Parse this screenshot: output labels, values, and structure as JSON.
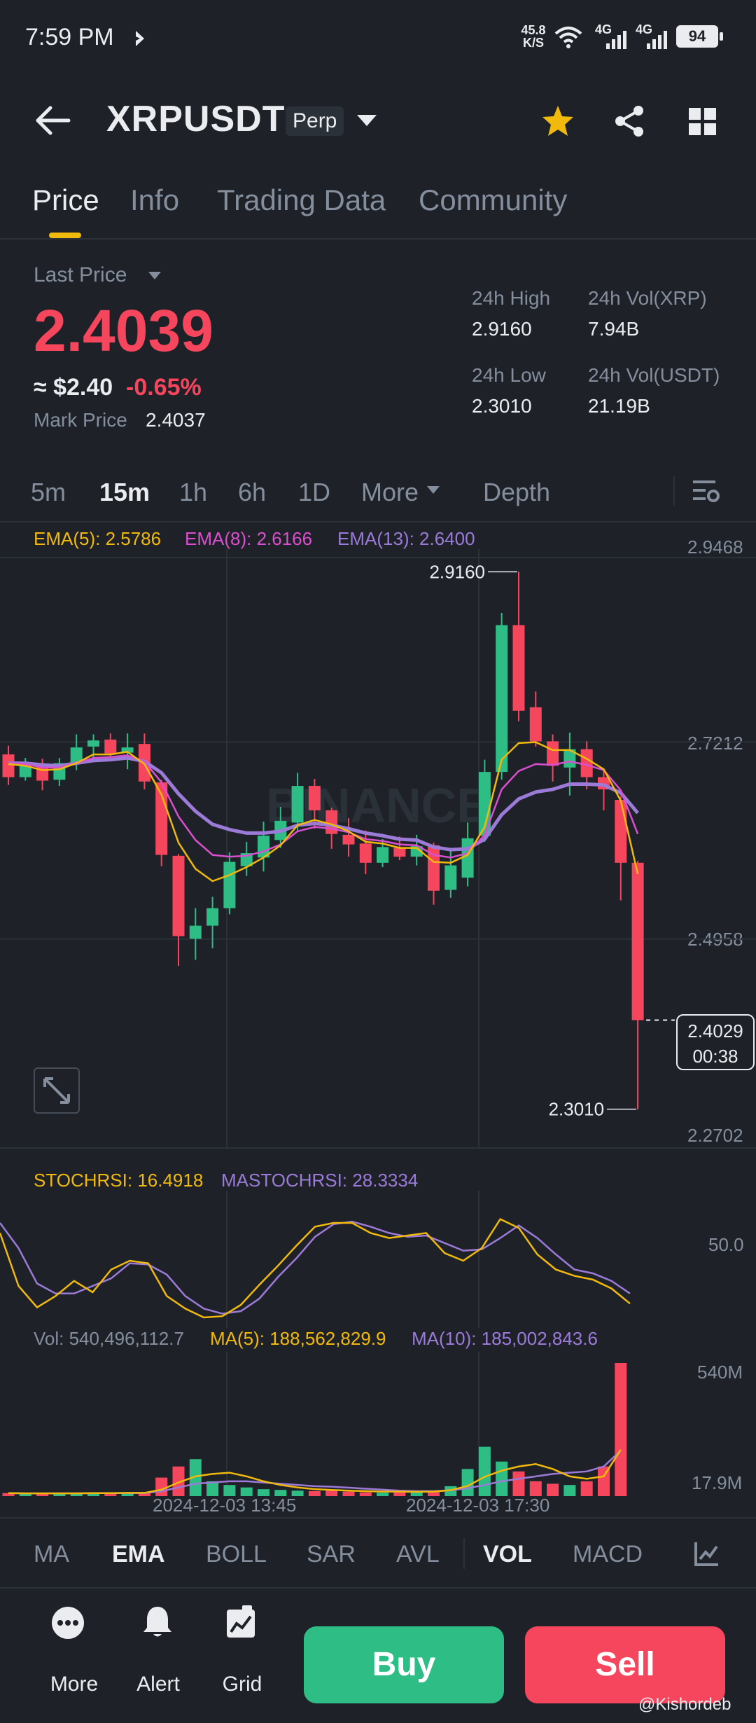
{
  "status_bar": {
    "time": "7:59 PM",
    "net_speed": "45.8",
    "net_unit": "K/S",
    "sig1": "4G",
    "sig2": "4G",
    "battery": "94"
  },
  "header": {
    "symbol": "XRPUSDT",
    "badge": "Perp"
  },
  "tabs": [
    {
      "label": "Price",
      "active": true
    },
    {
      "label": "Info"
    },
    {
      "label": "Trading Data"
    },
    {
      "label": "Community"
    }
  ],
  "ticker": {
    "last_price_label": "Last Price",
    "last_price": "2.4039",
    "approx_usd": "≈ $2.40",
    "change_pct": "-0.65%",
    "mark_price_label": "Mark Price",
    "mark_price": "2.4037",
    "high_label": "24h High",
    "high": "2.9160",
    "low_label": "24h Low",
    "low": "2.3010",
    "vol_xrp_label": "24h Vol(XRP)",
    "vol_xrp": "7.94B",
    "vol_usdt_label": "24h Vol(USDT)",
    "vol_usdt": "21.19B"
  },
  "intervals": [
    {
      "label": "5m"
    },
    {
      "label": "15m",
      "active": true
    },
    {
      "label": "1h"
    },
    {
      "label": "6h"
    },
    {
      "label": "1D"
    },
    {
      "label": "More"
    },
    {
      "label": "Depth"
    }
  ],
  "ema_legend": {
    "ema5": "EMA(5): 2.5786",
    "ema8": "EMA(8): 2.6166",
    "ema13": "EMA(13): 2.6400"
  },
  "price_axis": {
    "t1": "2.9468",
    "t2": "2.7212",
    "t3": "2.4958",
    "t4": "2.2702"
  },
  "chart_annotations": {
    "high": "2.9160",
    "low": "2.3010",
    "current_price": "2.4029",
    "countdown": "00:38"
  },
  "stoch_legend": {
    "stoch": "STOCHRSI: 16.4918",
    "ma": "MASTOCHRSI: 28.3334",
    "axis": "50.0"
  },
  "vol_legend": {
    "vol": "Vol: 540,496,112.7",
    "ma5": "MA(5): 188,562,829.9",
    "ma10": "MA(10): 185,002,843.6",
    "axis_top": "540M",
    "axis_bot": "17.9M"
  },
  "time_axis": {
    "t1": "2024-12-03 13:45",
    "t2": "2024-12-03 17:30"
  },
  "indicators": [
    {
      "label": "MA"
    },
    {
      "label": "EMA",
      "active": true
    },
    {
      "label": "BOLL"
    },
    {
      "label": "SAR"
    },
    {
      "label": "AVL"
    },
    {
      "label": "VOL",
      "active": true
    },
    {
      "label": "MACD"
    }
  ],
  "bottom_bar": {
    "more": "More",
    "alert": "Alert",
    "grid": "Grid",
    "buy": "Buy",
    "sell": "Sell"
  },
  "watermark": "@Kishordeb",
  "colors": {
    "up": "#2ebd85",
    "down": "#f6465d",
    "accent": "#f0b90b",
    "ema5": "#f0b90b",
    "ema8": "#d94fcf",
    "ema13": "#9b7ad8",
    "bg": "#1e2228"
  },
  "chart_data": {
    "type": "candlestick",
    "candles": [
      {
        "o": 2.707,
        "h": 2.717,
        "l": 2.672,
        "c": 2.681
      },
      {
        "o": 2.681,
        "h": 2.703,
        "l": 2.677,
        "c": 2.696
      },
      {
        "o": 2.695,
        "h": 2.702,
        "l": 2.666,
        "c": 2.677
      },
      {
        "o": 2.678,
        "h": 2.703,
        "l": 2.671,
        "c": 2.697
      },
      {
        "o": 2.696,
        "h": 2.73,
        "l": 2.689,
        "c": 2.715
      },
      {
        "o": 2.716,
        "h": 2.73,
        "l": 2.7,
        "c": 2.723
      },
      {
        "o": 2.724,
        "h": 2.731,
        "l": 2.704,
        "c": 2.708
      },
      {
        "o": 2.709,
        "h": 2.731,
        "l": 2.69,
        "c": 2.715
      },
      {
        "o": 2.719,
        "h": 2.731,
        "l": 2.667,
        "c": 2.676
      },
      {
        "o": 2.675,
        "h": 2.678,
        "l": 2.579,
        "c": 2.592
      },
      {
        "o": 2.591,
        "h": 2.593,
        "l": 2.465,
        "c": 2.499
      },
      {
        "o": 2.496,
        "h": 2.531,
        "l": 2.472,
        "c": 2.511
      },
      {
        "o": 2.511,
        "h": 2.544,
        "l": 2.485,
        "c": 2.531
      },
      {
        "o": 2.531,
        "h": 2.595,
        "l": 2.524,
        "c": 2.584
      },
      {
        "o": 2.579,
        "h": 2.607,
        "l": 2.568,
        "c": 2.594
      },
      {
        "o": 2.589,
        "h": 2.63,
        "l": 2.573,
        "c": 2.614
      },
      {
        "o": 2.609,
        "h": 2.647,
        "l": 2.6,
        "c": 2.631
      },
      {
        "o": 2.629,
        "h": 2.686,
        "l": 2.619,
        "c": 2.671
      },
      {
        "o": 2.671,
        "h": 2.679,
        "l": 2.622,
        "c": 2.643
      },
      {
        "o": 2.643,
        "h": 2.646,
        "l": 2.599,
        "c": 2.616
      },
      {
        "o": 2.615,
        "h": 2.634,
        "l": 2.59,
        "c": 2.604
      },
      {
        "o": 2.605,
        "h": 2.62,
        "l": 2.57,
        "c": 2.583
      },
      {
        "o": 2.583,
        "h": 2.61,
        "l": 2.578,
        "c": 2.601
      },
      {
        "o": 2.6,
        "h": 2.613,
        "l": 2.586,
        "c": 2.59
      },
      {
        "o": 2.59,
        "h": 2.615,
        "l": 2.58,
        "c": 2.602
      },
      {
        "o": 2.603,
        "h": 2.606,
        "l": 2.535,
        "c": 2.551
      },
      {
        "o": 2.552,
        "h": 2.597,
        "l": 2.543,
        "c": 2.58
      },
      {
        "o": 2.566,
        "h": 2.629,
        "l": 2.556,
        "c": 2.611
      },
      {
        "o": 2.614,
        "h": 2.701,
        "l": 2.607,
        "c": 2.687
      },
      {
        "o": 2.687,
        "h": 2.869,
        "l": 2.678,
        "c": 2.855
      },
      {
        "o": 2.855,
        "h": 2.916,
        "l": 2.745,
        "c": 2.757
      },
      {
        "o": 2.761,
        "h": 2.779,
        "l": 2.716,
        "c": 2.722
      },
      {
        "o": 2.722,
        "h": 2.73,
        "l": 2.676,
        "c": 2.694
      },
      {
        "o": 2.692,
        "h": 2.732,
        "l": 2.66,
        "c": 2.713
      },
      {
        "o": 2.713,
        "h": 2.722,
        "l": 2.667,
        "c": 2.681
      },
      {
        "o": 2.681,
        "h": 2.689,
        "l": 2.643,
        "c": 2.667
      },
      {
        "o": 2.655,
        "h": 2.659,
        "l": 2.54,
        "c": 2.583
      },
      {
        "o": 2.583,
        "h": 2.585,
        "l": 2.301,
        "c": 2.4029
      }
    ],
    "ema5": [
      2.696,
      2.694,
      2.689,
      2.69,
      2.697,
      2.707,
      2.707,
      2.71,
      2.696,
      2.661,
      2.606,
      2.576,
      2.562,
      2.569,
      2.578,
      2.589,
      2.603,
      2.626,
      2.632,
      2.627,
      2.619,
      2.607,
      2.605,
      2.6,
      2.6,
      2.584,
      2.583,
      2.592,
      2.624,
      2.701,
      2.72,
      2.721,
      2.712,
      2.712,
      2.702,
      2.69,
      2.654,
      2.57
    ],
    "ema8": [
      2.697,
      2.696,
      2.692,
      2.692,
      2.697,
      2.703,
      2.704,
      2.706,
      2.699,
      2.675,
      2.636,
      2.609,
      2.592,
      2.59,
      2.591,
      2.596,
      2.604,
      2.619,
      2.624,
      2.622,
      2.618,
      2.61,
      2.608,
      2.604,
      2.603,
      2.592,
      2.589,
      2.594,
      2.615,
      2.667,
      2.688,
      2.696,
      2.695,
      2.699,
      2.695,
      2.689,
      2.666,
      2.616
    ],
    "ema13": [
      2.697,
      2.697,
      2.695,
      2.694,
      2.697,
      2.7,
      2.701,
      2.703,
      2.699,
      2.686,
      2.662,
      2.642,
      2.627,
      2.621,
      2.617,
      2.617,
      2.619,
      2.626,
      2.628,
      2.626,
      2.622,
      2.617,
      2.614,
      2.61,
      2.609,
      2.601,
      2.598,
      2.599,
      2.61,
      2.638,
      2.656,
      2.664,
      2.667,
      2.673,
      2.673,
      2.672,
      2.663,
      2.64
    ],
    "stochrsi": [
      72,
      30,
      13,
      22,
      34,
      25,
      43,
      50,
      48,
      22,
      12,
      5,
      6,
      15,
      31,
      46,
      62,
      77,
      80,
      80,
      72,
      68,
      70,
      72,
      56,
      50,
      60,
      83,
      76,
      55,
      43,
      38,
      35,
      28,
      16
    ],
    "mastochrsi": [
      80,
      60,
      32,
      24,
      24,
      30,
      36,
      48,
      47,
      39,
      22,
      12,
      8,
      10,
      20,
      37,
      52,
      69,
      79,
      81,
      77,
      72,
      69,
      70,
      64,
      58,
      59,
      68,
      78,
      68,
      55,
      43,
      40,
      34,
      24
    ],
    "volume": [
      12,
      10,
      10,
      11,
      11,
      12,
      13,
      14,
      12,
      75,
      120,
      150,
      60,
      45,
      35,
      28,
      25,
      22,
      20,
      24,
      18,
      15,
      14,
      16,
      18,
      22,
      40,
      110,
      200,
      140,
      100,
      60,
      50,
      45,
      60,
      120,
      540
    ],
    "vol_ma5": [
      12,
      11,
      11,
      11,
      11,
      12,
      12,
      13,
      13,
      26,
      55,
      80,
      90,
      95,
      80,
      60,
      45,
      35,
      28,
      25,
      22,
      20,
      18,
      18,
      17,
      18,
      24,
      41,
      78,
      103,
      120,
      130,
      110,
      80,
      70,
      80,
      188
    ],
    "vol_ma10": [
      12,
      11,
      11,
      11,
      11,
      12,
      12,
      12,
      12,
      20,
      35,
      50,
      55,
      60,
      60,
      55,
      50,
      45,
      40,
      38,
      34,
      30,
      26,
      22,
      20,
      20,
      23,
      32,
      45,
      60,
      70,
      80,
      90,
      95,
      100,
      120,
      185
    ]
  }
}
